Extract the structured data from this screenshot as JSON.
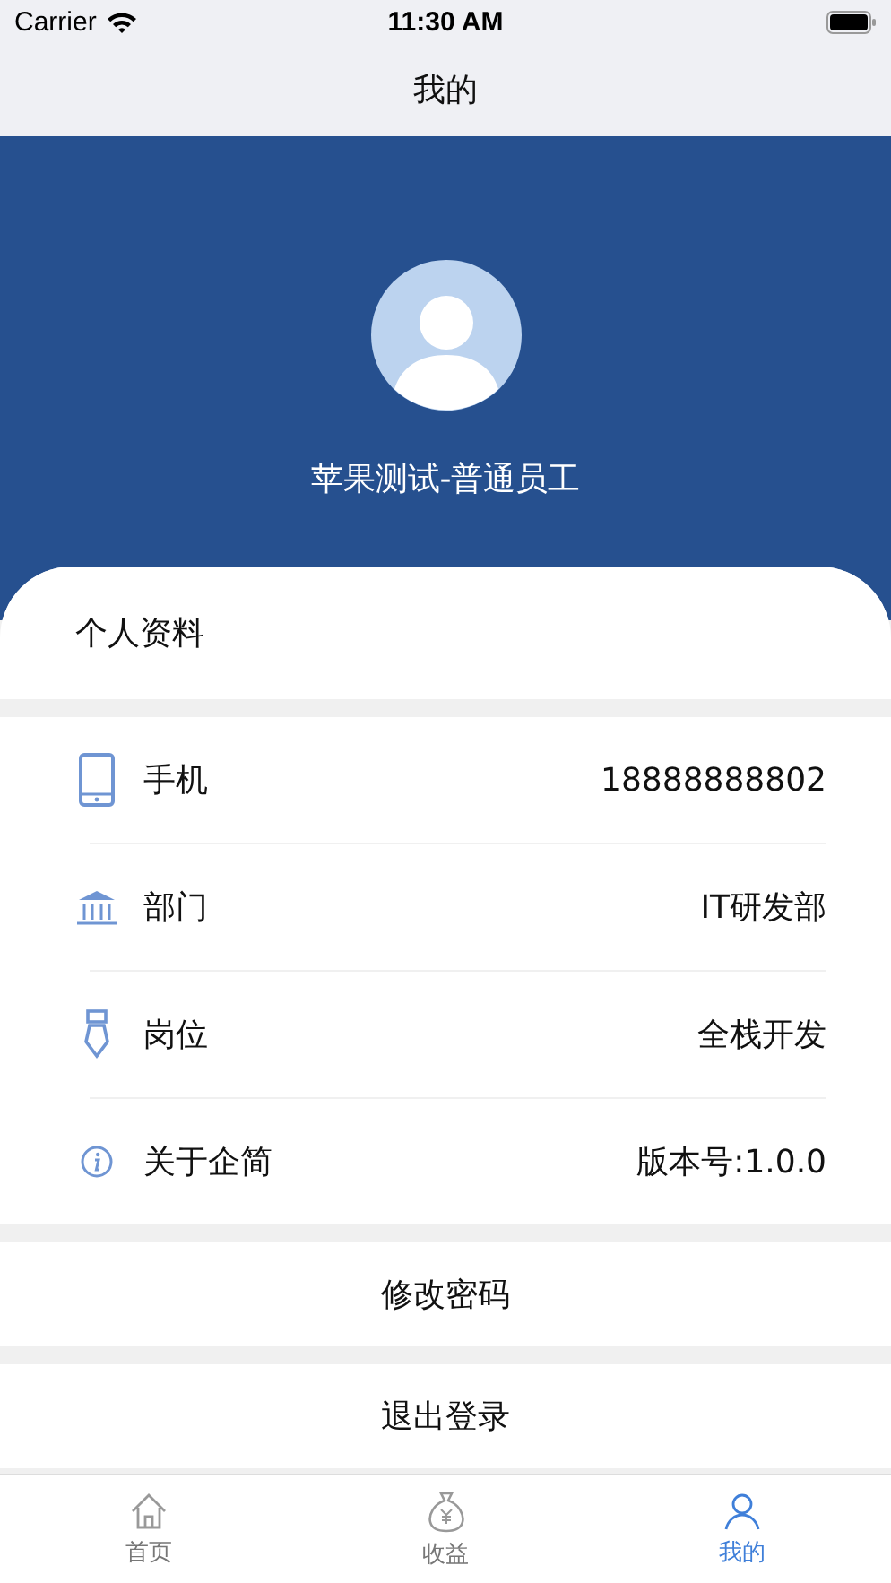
{
  "status_bar": {
    "carrier": "Carrier",
    "time": "11:30 AM"
  },
  "nav_bar": {
    "title": "我的"
  },
  "profile": {
    "name": "苹果测试-普通员工"
  },
  "section": {
    "title": "个人资料"
  },
  "info_rows": [
    {
      "label": "手机",
      "value": "18888888802"
    },
    {
      "label": "部门",
      "value": "IT研发部"
    },
    {
      "label": "岗位",
      "value": "全栈开发"
    },
    {
      "label": "关于企简",
      "value": "版本号:1.0.0"
    }
  ],
  "actions": [
    "修改密码",
    "退出登录"
  ],
  "tabs": [
    {
      "label": "首页",
      "selected": false
    },
    {
      "label": "收益",
      "selected": false
    },
    {
      "label": "我的",
      "selected": true
    }
  ]
}
